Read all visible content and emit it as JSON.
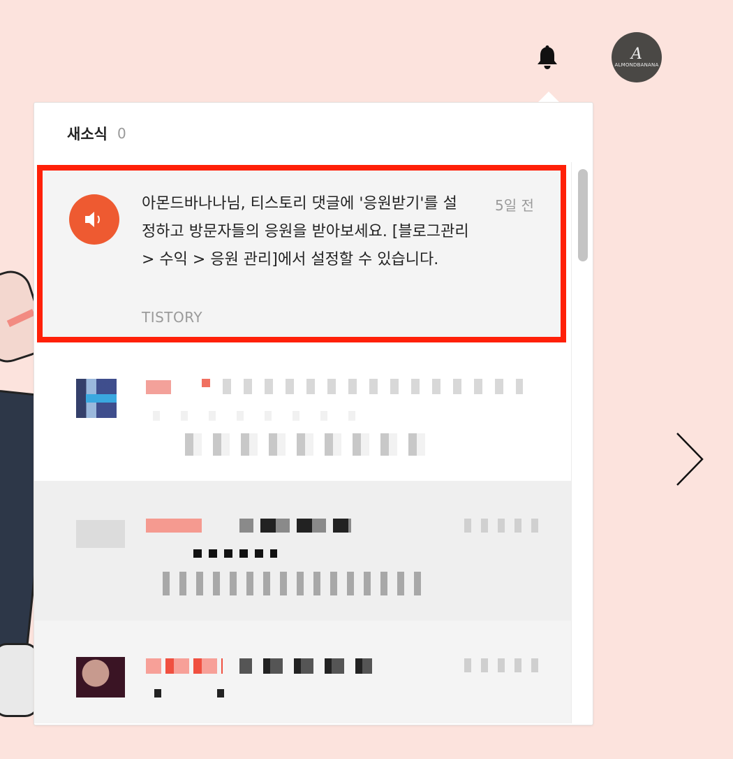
{
  "topbar": {
    "bell_icon": "bell-icon",
    "avatar_text": "ALMONDBANANA",
    "avatar_mono": "A"
  },
  "panel": {
    "title": "새소식",
    "count": "0"
  },
  "notifications": [
    {
      "icon": "speaker-icon",
      "text": "아몬드바나나님, 티스토리 댓글에 '응원받기'를 설정하고 방문자들의 응원을 받아보세요. [블로그관리 > 수익 > 응원 관리]에서 설정할 수 있습니다.",
      "source": "TISTORY",
      "time": "5일 전",
      "highlighted": true
    }
  ],
  "colors": {
    "background": "#fce3dd",
    "highlight_border": "#ff2008",
    "notice_icon": "#ee5a31"
  }
}
